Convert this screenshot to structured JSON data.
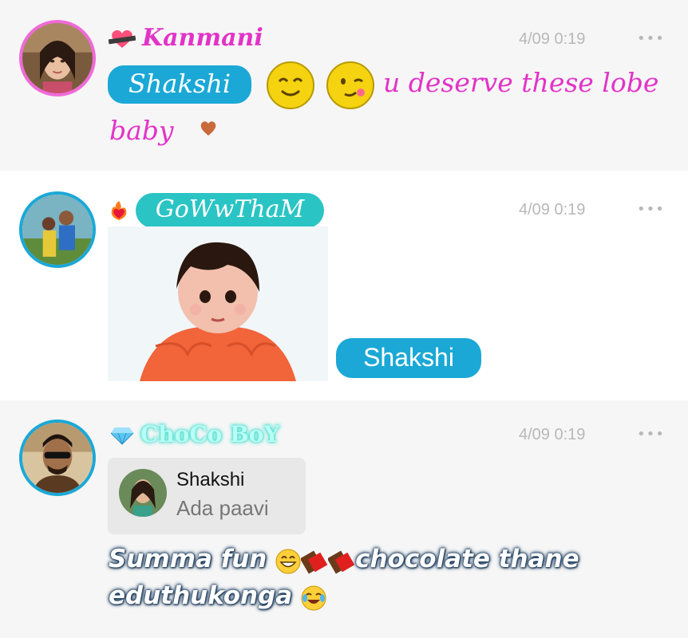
{
  "messages": [
    {
      "username": "Kanmani",
      "time": "4/09 0:19",
      "more": "•••",
      "mention": "Shakshi",
      "text_line1": "u deserve these lobe",
      "text_line2": "baby",
      "colors": {
        "username": "#e233c8",
        "mention_bg": "#1ba8d6",
        "avatar_ring": "#f06ad9"
      },
      "icons": [
        "heart-badge-icon",
        "smiling-face-icon",
        "winking-face-icon",
        "small-heart-icon"
      ]
    },
    {
      "username": "GoWwThaM",
      "time": "4/09 0:19",
      "more": "•••",
      "mention": "Shakshi",
      "image": "baby-photo",
      "colors": {
        "username": "#ffffff",
        "username_bg": "#2bc4c4",
        "mention_bg": "#1ba8d6",
        "avatar_ring": "#1ba8d6"
      },
      "icons": [
        "fire-heart-icon"
      ]
    },
    {
      "username": "ChoCo BoY",
      "time": "4/09 0:19",
      "more": "•••",
      "reply": {
        "name": "Shakshi",
        "text": "Ada paavi"
      },
      "text_line1_a": "Summa fun",
      "text_line1_b": "chocolate thane",
      "text_line2": "eduthukonga",
      "colors": {
        "username": "#b8fff5",
        "avatar_ring": "#1ba8d6"
      },
      "icons": [
        "diamond-icon",
        "grinning-face-icon",
        "chocolate-bar-icon",
        "laughing-tears-icon"
      ]
    }
  ]
}
